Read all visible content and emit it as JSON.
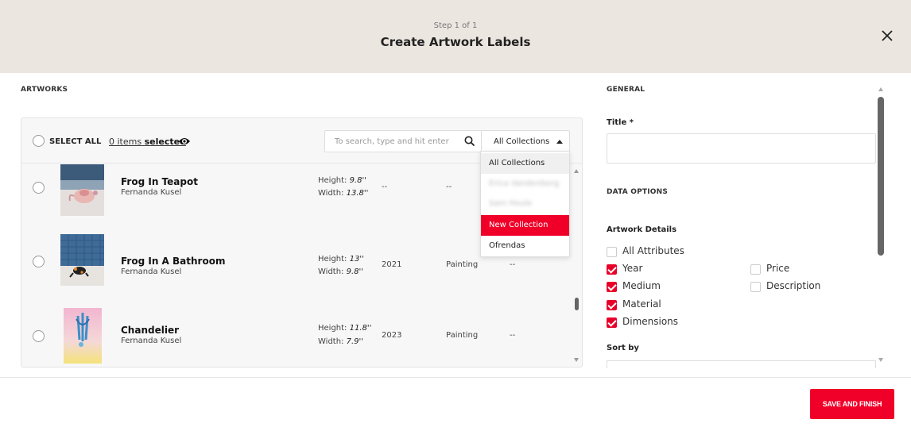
{
  "header": {
    "step": "Step 1 of 1",
    "title": "Create Artwork Labels",
    "close_icon": "close-icon"
  },
  "artworks": {
    "section_label": "ARTWORKS",
    "select_all_label": "SELECT ALL",
    "items_selected_count": "0 items",
    "items_selected_word": "selected",
    "search_placeholder": "To search, type and hit enter",
    "collection_filter": "All Collections",
    "dropdown_options": [
      "All Collections",
      "Erica Vandenberg",
      "Sam Houle",
      "New Collection",
      "Ofrendas"
    ],
    "dropdown_highlighted": "New Collection",
    "rows": [
      {
        "title": "Frog In Teapot",
        "artist": "Fernanda Kusel",
        "height_label": "Height:",
        "height": "9.8''",
        "width_label": "Width:",
        "width": "13.8''",
        "year": "--",
        "medium": "--"
      },
      {
        "title": "Frog In A Bathroom",
        "artist": "Fernanda Kusel",
        "height_label": "Height:",
        "height": "13''",
        "width_label": "Width:",
        "width": "9.8''",
        "year": "2021",
        "medium": "Painting",
        "extra": "--"
      },
      {
        "title": "Chandelier",
        "artist": "Fernanda Kusel",
        "height_label": "Height:",
        "height": "11.8''",
        "width_label": "Width:",
        "width": "7.9''",
        "year": "2023",
        "medium": "Painting",
        "extra": "--"
      }
    ]
  },
  "general": {
    "section_label": "GENERAL",
    "title_label": "Title *",
    "title_value": "",
    "data_options_label": "DATA OPTIONS",
    "artwork_details_label": "Artwork Details",
    "options": {
      "all_attributes": {
        "label": "All Attributes",
        "checked": false
      },
      "year": {
        "label": "Year",
        "checked": true
      },
      "price": {
        "label": "Price",
        "checked": false
      },
      "medium": {
        "label": "Medium",
        "checked": true
      },
      "description": {
        "label": "Description",
        "checked": false
      },
      "material": {
        "label": "Material",
        "checked": true
      },
      "dimensions": {
        "label": "Dimensions",
        "checked": true
      }
    },
    "sort_by_label": "Sort by"
  },
  "footer": {
    "save_label": "SAVE AND FINISH"
  },
  "colors": {
    "accent": "#f00028",
    "header_bg": "#ece6e1",
    "panel_bg": "#f7f7f7"
  }
}
